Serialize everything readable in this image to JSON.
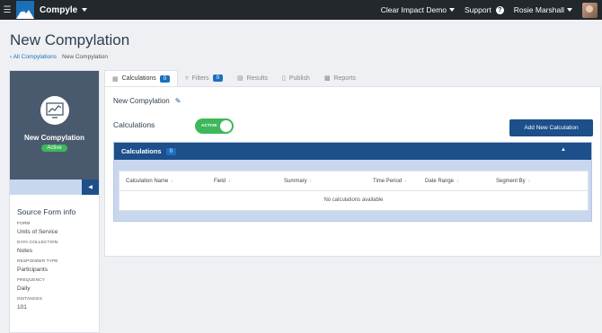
{
  "topbar": {
    "app_name": "Compyle",
    "org": "Clear Impact Demo",
    "support": "Support",
    "user": "Rosie Marshall"
  },
  "page": {
    "title": "New Compylation",
    "breadcrumb": [
      "All Compylations",
      "New Compylation"
    ]
  },
  "sidebar": {
    "title": "New Compylation",
    "status": "Active",
    "section_title": "Source Form info",
    "info": [
      {
        "label": "FORM",
        "value": "Units of Service"
      },
      {
        "label": "DATA COLLECTION",
        "value": "Notes"
      },
      {
        "label": "RESPONDER TYPE",
        "value": "Participants"
      },
      {
        "label": "FREQUENCY",
        "value": "Daily"
      },
      {
        "label": "INSTANCES",
        "value": "101"
      }
    ]
  },
  "tabs": [
    {
      "label": "Calculations",
      "badge": "0",
      "icon": "calculator-icon"
    },
    {
      "label": "Filters",
      "badge": "0",
      "icon": "filter-icon"
    },
    {
      "label": "Results",
      "icon": "list-icon"
    },
    {
      "label": "Publish",
      "icon": "document-icon"
    },
    {
      "label": "Reports",
      "icon": "report-icon"
    }
  ],
  "main": {
    "name": "New Compylation",
    "calculations_label": "Calculations",
    "toggle_label": "ACTIVE",
    "add_button": "Add New Calculation",
    "panel_title": "Calculations",
    "panel_badge": "0",
    "columns": [
      "Calculation Name",
      "Field",
      "Summary",
      "Time Period",
      "Date Range",
      "Segment By"
    ],
    "empty_text": "No calculations available"
  },
  "colors": {
    "topbar": "#23282d",
    "primary": "#1d4f8a",
    "accent_green": "#3eb75a",
    "hero": "#4a5a6e"
  }
}
